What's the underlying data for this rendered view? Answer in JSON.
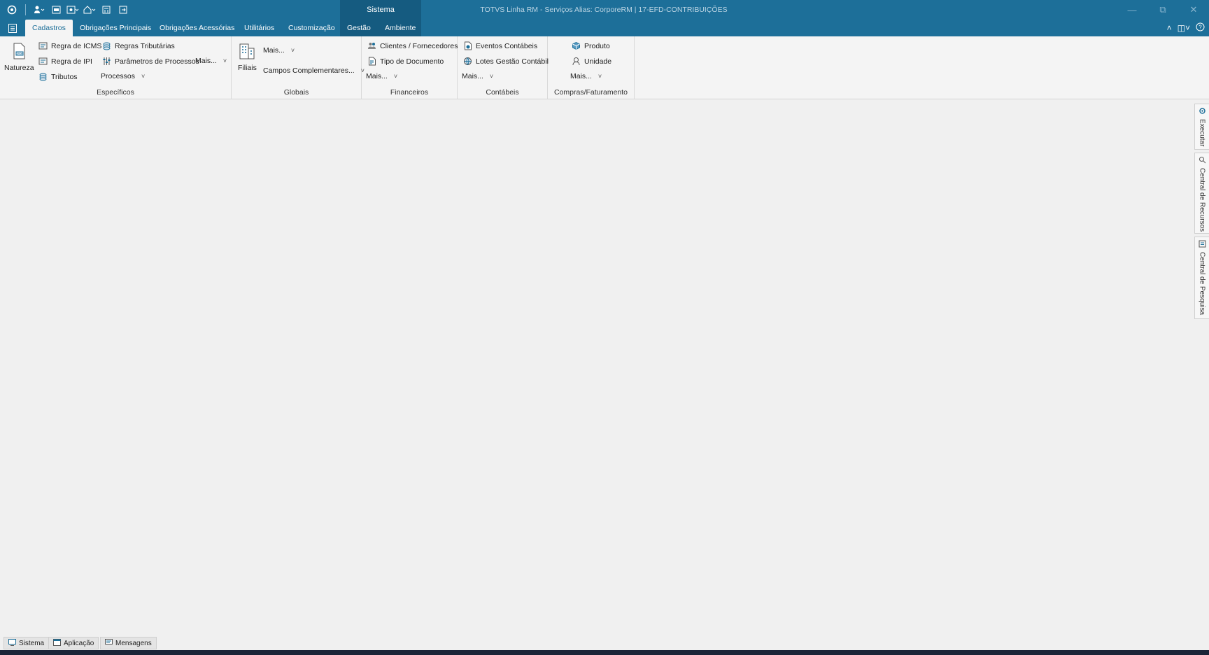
{
  "window": {
    "title": "TOTVS Linha RM - Serviços  Alias: CorporeRM | 17-EFD-CONTRIBUIÇÕES",
    "context_tab": "Sistema"
  },
  "tabs": [
    "Cadastros",
    "Obrigações Principais",
    "Obrigações Acessórias",
    "Utilitários",
    "Customização",
    "Gestão",
    "Ambiente"
  ],
  "active_tab": "Cadastros",
  "ribbon": {
    "especificos": {
      "label": "Específicos",
      "natureza": "Natureza",
      "regra_icms": "Regra de ICMS",
      "regra_ipi": "Regra de IPI",
      "tributos": "Tributos",
      "regras_tributarias": "Regras Tributárias",
      "parametros_processos": "Parâmetros de Processos",
      "mais": "Mais...",
      "processos": "Processos"
    },
    "globais": {
      "label": "Globais",
      "filiais": "Filiais",
      "mais": "Mais...",
      "campos_complementares": "Campos Complementares..."
    },
    "financeiros": {
      "label": "Financeiros",
      "clientes_fornecedores": "Clientes / Fornecedores",
      "tipo_documento": "Tipo de Documento",
      "mais": "Mais..."
    },
    "contabeis": {
      "label": "Contábeis",
      "eventos_contabeis": "Eventos Contábeis",
      "lotes_gestao": "Lotes Gestão Contábil",
      "mais": "Mais..."
    },
    "compras": {
      "label": "Compras/Faturamento",
      "produto": "Produto",
      "unidade": "Unidade",
      "mais": "Mais..."
    }
  },
  "side_panels": [
    "Executar",
    "Central de Recursos",
    "Central de Pesquisa"
  ],
  "status_bar": [
    "Sistema",
    "Aplicação",
    "Mensagens"
  ],
  "colors": {
    "title_bar": "#1d6f99",
    "context_tab": "#155b80"
  }
}
